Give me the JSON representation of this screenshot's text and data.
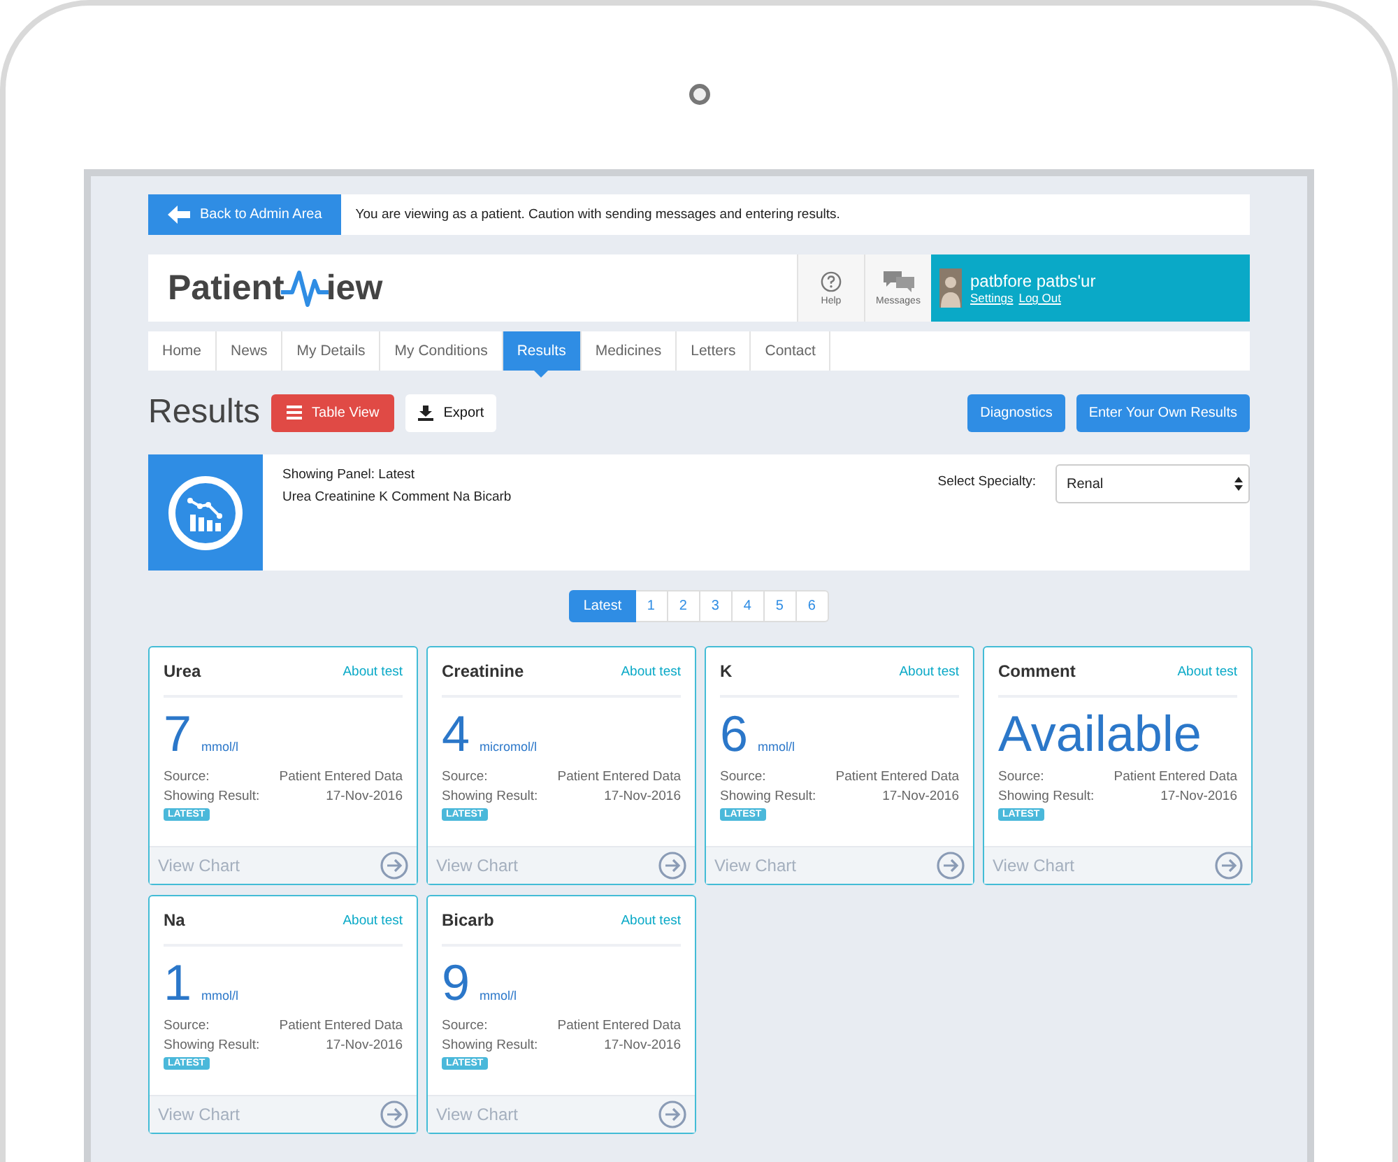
{
  "banner": {
    "back_button": "Back to Admin Area",
    "message": "You are viewing as a patient. Caution with sending messages and entering results."
  },
  "header": {
    "logo_left": "Patient",
    "logo_right": "iew",
    "help": "Help",
    "messages": "Messages",
    "user_name": "patbfore patbs'ur",
    "user_links": [
      "Settings",
      "Log Out"
    ]
  },
  "nav": [
    {
      "label": "Home",
      "selected": false
    },
    {
      "label": "News",
      "selected": false
    },
    {
      "label": "My Details",
      "selected": false
    },
    {
      "label": "My Conditions",
      "selected": false
    },
    {
      "label": "Results",
      "selected": true
    },
    {
      "label": "Medicines",
      "selected": false
    },
    {
      "label": "Letters",
      "selected": false
    },
    {
      "label": "Contact",
      "selected": false
    }
  ],
  "page": {
    "title": "Results",
    "table_view": "Table View",
    "export": "Export",
    "actions": [
      "Diagnostics",
      "Enter Your Own Results"
    ]
  },
  "panel": {
    "showing": "Showing Panel: Latest",
    "tests": "Urea Creatinine K Comment Na Bicarb",
    "specialty_label": "Select Specialty:",
    "specialty": "Renal"
  },
  "pagination": [
    {
      "label": "Latest",
      "selected": true
    },
    {
      "label": "1",
      "selected": false
    },
    {
      "label": "2",
      "selected": false
    },
    {
      "label": "3",
      "selected": false
    },
    {
      "label": "4",
      "selected": false
    },
    {
      "label": "5",
      "selected": false
    },
    {
      "label": "6",
      "selected": false
    }
  ],
  "cards": [
    {
      "name": "Urea",
      "about": "About test",
      "value": "7",
      "unit": "mmol/l",
      "source_label": "Source:",
      "source": "Patient Entered Data",
      "date_label": "Showing Result:",
      "date": "17-Nov-2016",
      "badge": "LATEST",
      "chart_link": "View Chart"
    },
    {
      "name": "Creatinine",
      "about": "About test",
      "value": "4",
      "unit": "micromol/l",
      "source_label": "Source:",
      "source": "Patient Entered Data",
      "date_label": "Showing Result:",
      "date": "17-Nov-2016",
      "badge": "LATEST",
      "chart_link": "View Chart"
    },
    {
      "name": "K",
      "about": "About test",
      "value": "6",
      "unit": "mmol/l",
      "source_label": "Source:",
      "source": "Patient Entered Data",
      "date_label": "Showing Result:",
      "date": "17-Nov-2016",
      "badge": "LATEST",
      "chart_link": "View Chart"
    },
    {
      "name": "Comment",
      "about": "About test",
      "value": "Available",
      "source_label": "Source:",
      "source": "Patient Entered Data",
      "date_label": "Showing Result:",
      "date": "17-Nov-2016",
      "badge": "LATEST",
      "chart_link": "View Chart"
    },
    {
      "name": "Na",
      "about": "About test",
      "value": "1",
      "unit": "mmol/l",
      "source_label": "Source:",
      "source": "Patient Entered Data",
      "date_label": "Showing Result:",
      "date": "17-Nov-2016",
      "badge": "LATEST",
      "chart_link": "View Chart"
    },
    {
      "name": "Bicarb",
      "about": "About test",
      "value": "9",
      "unit": "mmol/l",
      "source_label": "Source:",
      "source": "Patient Entered Data",
      "date_label": "Showing Result:",
      "date": "17-Nov-2016",
      "badge": "LATEST",
      "chart_link": "View Chart"
    }
  ]
}
